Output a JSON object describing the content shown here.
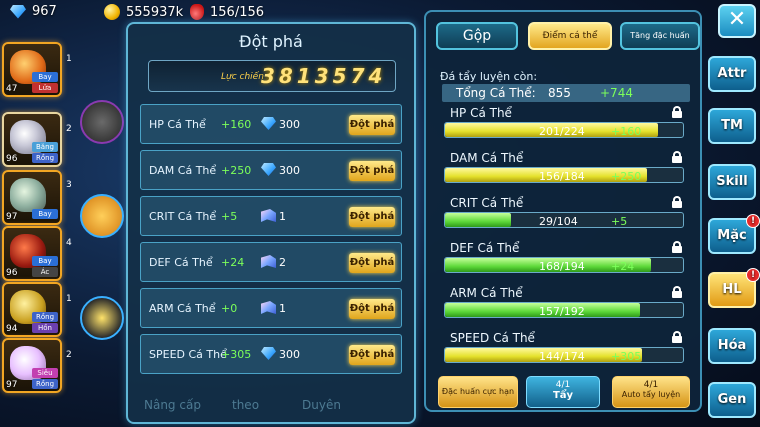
{
  "resources": {
    "gems": "967",
    "gold": "555937k",
    "stamina": "156/156"
  },
  "roster": [
    {
      "level": "47",
      "slot": "1",
      "tags": [
        "Bay",
        "Lửa"
      ]
    },
    {
      "level": "96",
      "slot": "2",
      "tags": [
        "Băng",
        "Rồng"
      ]
    },
    {
      "level": "97",
      "slot": "3",
      "tags": [
        "Bay",
        ""
      ]
    },
    {
      "level": "96",
      "slot": "4",
      "tags": [
        "Bay",
        "Ác"
      ]
    },
    {
      "level": "94",
      "slot": "1",
      "tags": [
        "Rồng",
        "Hồn"
      ]
    },
    {
      "level": "97",
      "slot": "2",
      "tags": [
        "Siêu",
        "Rồng"
      ]
    }
  ],
  "breakthrough": {
    "title": "Đột phá",
    "power_label": "Lực chiến",
    "power_value": "3813574",
    "rows": [
      {
        "label": "HP Cá Thể",
        "bonus": "+160",
        "cost_icon": "gem-icon",
        "cost": "300",
        "button": "Đột phá"
      },
      {
        "label": "DAM Cá Thể",
        "bonus": "+250",
        "cost_icon": "gem-icon",
        "cost": "300",
        "button": "Đột phá"
      },
      {
        "label": "CRIT Cá Thể",
        "bonus": "+5",
        "cost_icon": "book-icon",
        "cost": "1",
        "button": "Đột phá"
      },
      {
        "label": "DEF Cá Thể",
        "bonus": "+24",
        "cost_icon": "book-icon",
        "cost": "2",
        "button": "Đột phá"
      },
      {
        "label": "ARM Cá Thể",
        "bonus": "+0",
        "cost_icon": "book-icon",
        "cost": "1",
        "button": "Đột phá"
      },
      {
        "label": "SPEED Cá Thể",
        "bonus": "+305",
        "cost_icon": "gem-icon",
        "cost": "300",
        "button": "Đột phá"
      }
    ],
    "bottom_tabs": [
      "Nâng cấp",
      "theo",
      "Duyên"
    ]
  },
  "training": {
    "tabs": [
      "Gộp",
      "Điểm cá thể",
      "Tăng đặc huấn"
    ],
    "remain_label": "Đá tẩy luyện còn:",
    "total_label": "Tổng Cá Thể:",
    "total_value": "855",
    "total_bonus": "+744",
    "stats": [
      {
        "label": "HP Cá Thể",
        "value": "201/224",
        "bonus": "+160",
        "fill": 0.897,
        "color": "yellow"
      },
      {
        "label": "DAM Cá Thể",
        "value": "156/184",
        "bonus": "+250",
        "fill": 0.848,
        "color": "yellow"
      },
      {
        "label": "CRIT Cá Thể",
        "value": "29/104",
        "bonus": "+5",
        "fill": 0.279,
        "color": "green"
      },
      {
        "label": "DEF Cá Thể",
        "value": "168/194",
        "bonus": "+24",
        "fill": 0.866,
        "color": "green"
      },
      {
        "label": "ARM Cá Thể",
        "value": "157/192",
        "bonus": "",
        "fill": 0.818,
        "color": "green"
      },
      {
        "label": "SPEED Cá Thể",
        "value": "144/174",
        "bonus": "+305",
        "fill": 0.828,
        "color": "yellow"
      }
    ],
    "actions": [
      {
        "label": "Đặc huấn cực hạn",
        "count": ""
      },
      {
        "label": "Tẩy",
        "count": "4/1"
      },
      {
        "label": "Auto tẩy luyện",
        "count": "4/1"
      }
    ]
  },
  "side_menu": [
    {
      "label": "Attr",
      "badge": ""
    },
    {
      "label": "TM",
      "badge": ""
    },
    {
      "label": "Skill",
      "badge": ""
    },
    {
      "label": "Mặc",
      "badge": "!"
    },
    {
      "label": "HL",
      "badge": "!"
    },
    {
      "label": "Hóa",
      "badge": ""
    },
    {
      "label": "Gen",
      "badge": ""
    }
  ]
}
